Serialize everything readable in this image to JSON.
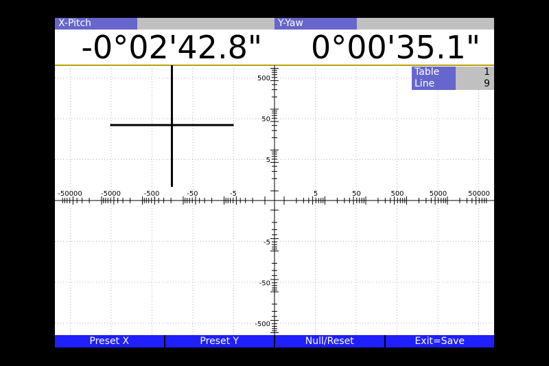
{
  "colors": {
    "header_tab": "#6666cc",
    "header_rest": "#c0c0c0",
    "softkey": "#1f1fff",
    "divider": "#b8a000",
    "grid": "#b0b0b0",
    "crosshair": "#000000"
  },
  "header": {
    "x_label": "X-Pitch",
    "y_label": "Y-Yaw",
    "x_reading": "-0°02'42.8\"",
    "y_reading": "0°00'35.1\""
  },
  "table_info": {
    "table_label": "Table",
    "table_value": "1",
    "line_label": "Line",
    "line_value": "9"
  },
  "plot": {
    "scale": "log",
    "grid": true,
    "x_ticks_neg": [
      "-50000",
      "-5000",
      "-500",
      "-50",
      "-5"
    ],
    "x_ticks_pos": [
      "5",
      "50",
      "500",
      "5000",
      "50000"
    ],
    "y_ticks_pos": [
      "500",
      "50",
      "5"
    ],
    "y_ticks_neg": [
      "-5",
      "-50",
      "-500"
    ],
    "crosshair": {
      "x": -162.8,
      "y": 35.1
    }
  },
  "softkeys": [
    "Preset X",
    "Preset Y",
    "Null/Reset",
    "Exit=Save"
  ]
}
